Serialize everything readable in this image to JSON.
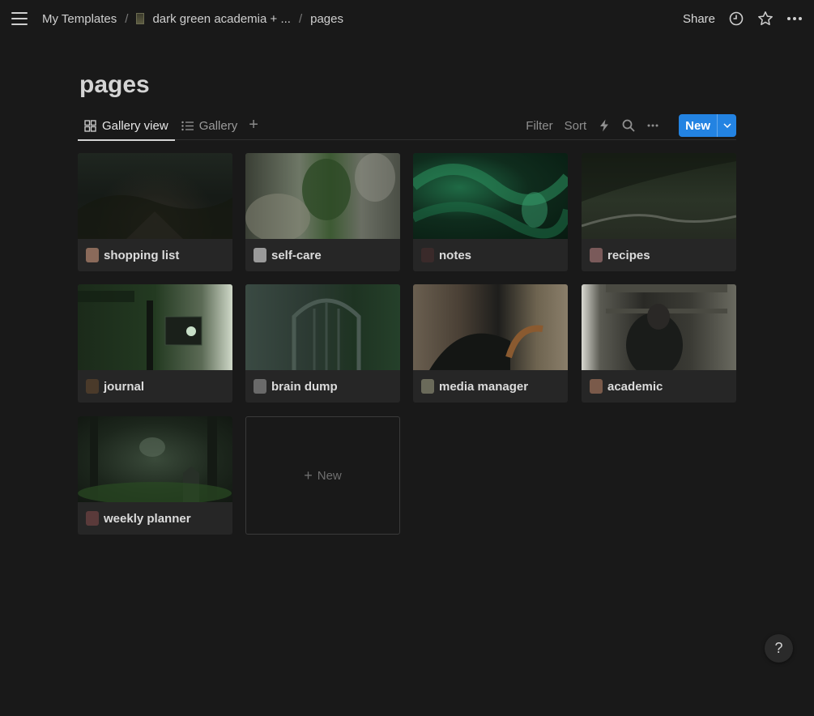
{
  "breadcrumb": {
    "items": [
      "My Templates",
      "dark green academia + ...",
      "pages"
    ]
  },
  "topbar": {
    "share_label": "Share"
  },
  "page": {
    "title": "pages"
  },
  "views": {
    "tabs": [
      {
        "label": "Gallery view",
        "icon": "gallery-grid-icon",
        "active": true
      },
      {
        "label": "Gallery",
        "icon": "list-icon",
        "active": false
      }
    ],
    "filter_label": "Filter",
    "sort_label": "Sort",
    "new_label": "New"
  },
  "gallery": {
    "cards": [
      {
        "title": "shopping list"
      },
      {
        "title": "self-care"
      },
      {
        "title": "notes"
      },
      {
        "title": "recipes"
      },
      {
        "title": "journal"
      },
      {
        "title": "brain dump"
      },
      {
        "title": "media manager"
      },
      {
        "title": "academic"
      },
      {
        "title": "weekly planner"
      }
    ],
    "new_card_label": "New"
  },
  "help": {
    "label": "?"
  },
  "colors": {
    "background": "#191919",
    "accent": "#2383e2",
    "card": "#262626"
  }
}
